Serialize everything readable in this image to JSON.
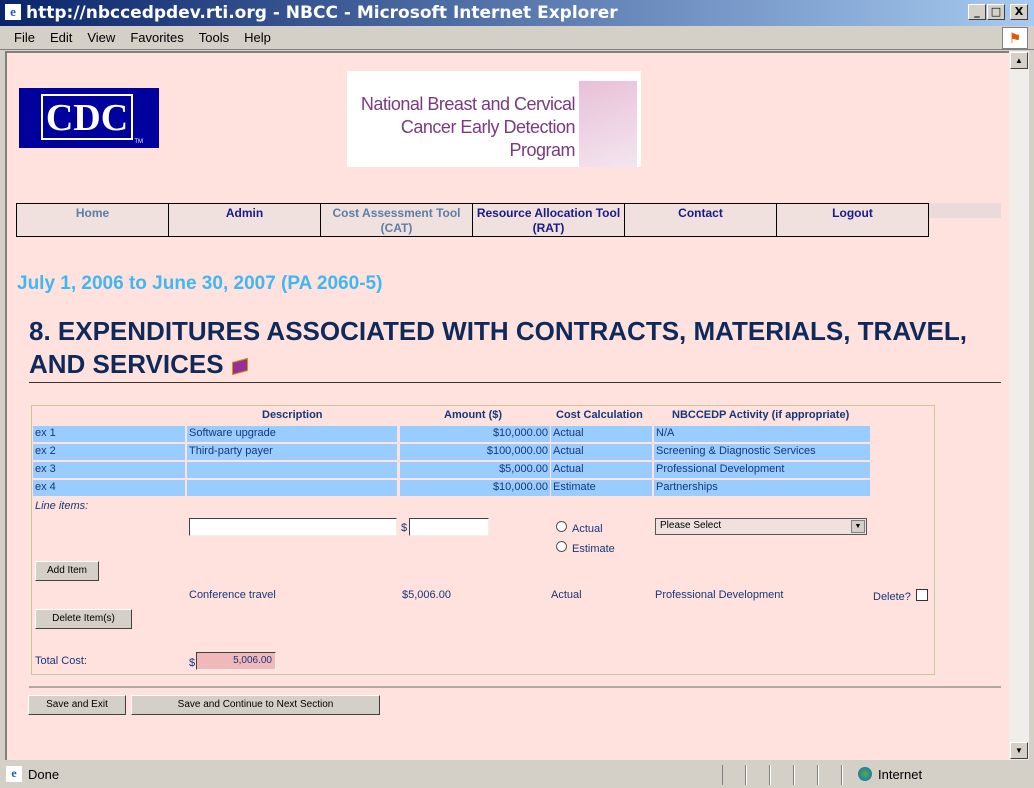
{
  "window": {
    "title": "http://nbccedpdev.rti.org - NBCC - Microsoft Internet Explorer",
    "controls": [
      "_",
      "□",
      "X"
    ]
  },
  "menu": [
    "File",
    "Edit",
    "View",
    "Favorites",
    "Tools",
    "Help"
  ],
  "logos": {
    "cdc": "CDC",
    "cdc_tm": "TM",
    "banner_line1": "National Breast and Cervical",
    "banner_line2": "Cancer Early Detection Program"
  },
  "nav": [
    "Home",
    "Admin",
    "Cost Assessment Tool (CAT)",
    "Resource Allocation Tool (RAT)",
    "Contact",
    "Logout"
  ],
  "period": "July 1, 2006 to June 30, 2007 (PA 2060-5)",
  "heading": "8. EXPENDITURES ASSOCIATED WITH CONTRACTS, MATERIALS, TRAVEL, AND SERVICES",
  "table": {
    "headers": [
      "Description",
      "Amount ($)",
      "Cost Calculation",
      "NBCCEDP Activity (if appropriate)"
    ],
    "examples": [
      {
        "label": "ex 1",
        "desc": "Software upgrade",
        "amount": "$10,000.00",
        "calc": "Actual",
        "activity": "N/A"
      },
      {
        "label": "ex 2",
        "desc": "Third-party payer",
        "amount": "$100,000.00",
        "calc": "Actual",
        "activity": "Screening & Diagnostic Services"
      },
      {
        "label": "ex 3",
        "desc": "",
        "amount": "$5,000.00",
        "calc": "Actual",
        "activity": "Professional Development"
      },
      {
        "label": "ex 4",
        "desc": "",
        "amount": "$10,000.00",
        "calc": "Estimate",
        "activity": "Partnerships"
      }
    ]
  },
  "form": {
    "line_items_label": "Line items:",
    "dollar": "$",
    "desc_value": "",
    "amount_value": "",
    "radio_actual": "Actual",
    "radio_estimate": "Estimate",
    "select_value": "Please Select",
    "add_button": "Add Item"
  },
  "items": [
    {
      "desc": "Conference travel",
      "amount": "$5,006.00",
      "calc": "Actual",
      "activity": "Professional Development",
      "delete_label": "Delete?"
    }
  ],
  "delete_button": "Delete Item(s)",
  "total": {
    "label": "Total Cost:",
    "dollar": "$",
    "value": "5,006.00"
  },
  "buttons": {
    "save_exit": "Save and Exit",
    "save_continue": "Save and Continue to Next Section"
  },
  "status": {
    "text": "Done",
    "zone": "Internet"
  }
}
